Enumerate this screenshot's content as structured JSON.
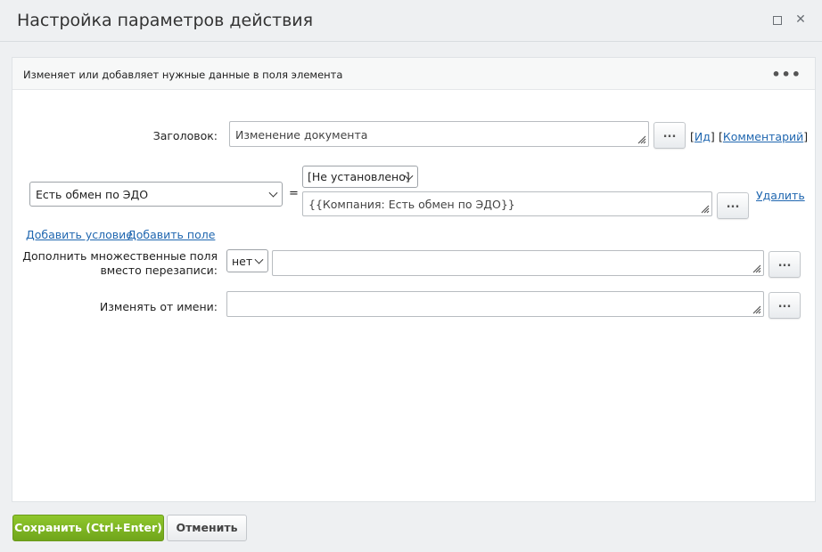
{
  "window": {
    "title": "Настройка параметров действия",
    "maximize_icon": "maximize-icon",
    "close_icon": "close-icon",
    "close_glyph": "✕"
  },
  "panel": {
    "description": "Изменяет или добавляет нужные данные в поля элемента",
    "menu_glyph": "•••"
  },
  "form": {
    "title_label": "Заголовок:",
    "title_value": "Изменение документа",
    "title_dots": "...",
    "id_link": "Ид",
    "comment_link": "Комментарий",
    "bracket_open": "[",
    "bracket_close": "]",
    "field_select": "Есть обмен по ЭДО",
    "equals": "=",
    "value_select": "[Не установлено]",
    "value_expr": "{{Компания: Есть обмен по ЭДО}}",
    "value_dots": "...",
    "delete_link": "Удалить",
    "add_condition_link": "Добавить условие",
    "add_field_link": "Добавить поле",
    "append_label_line1": "Дополнить множественные поля",
    "append_label_line2": "вместо перезаписи:",
    "append_select": "нет",
    "append_value": "",
    "append_dots": "...",
    "modify_as_label": "Изменять от имени:",
    "modify_as_value": "",
    "modify_as_dots": "..."
  },
  "footer": {
    "save_label": "Сохранить (Ctrl+Enter)",
    "cancel_label": "Отменить"
  },
  "colors": {
    "save_button": "#7bb423",
    "link": "#2067b0"
  }
}
